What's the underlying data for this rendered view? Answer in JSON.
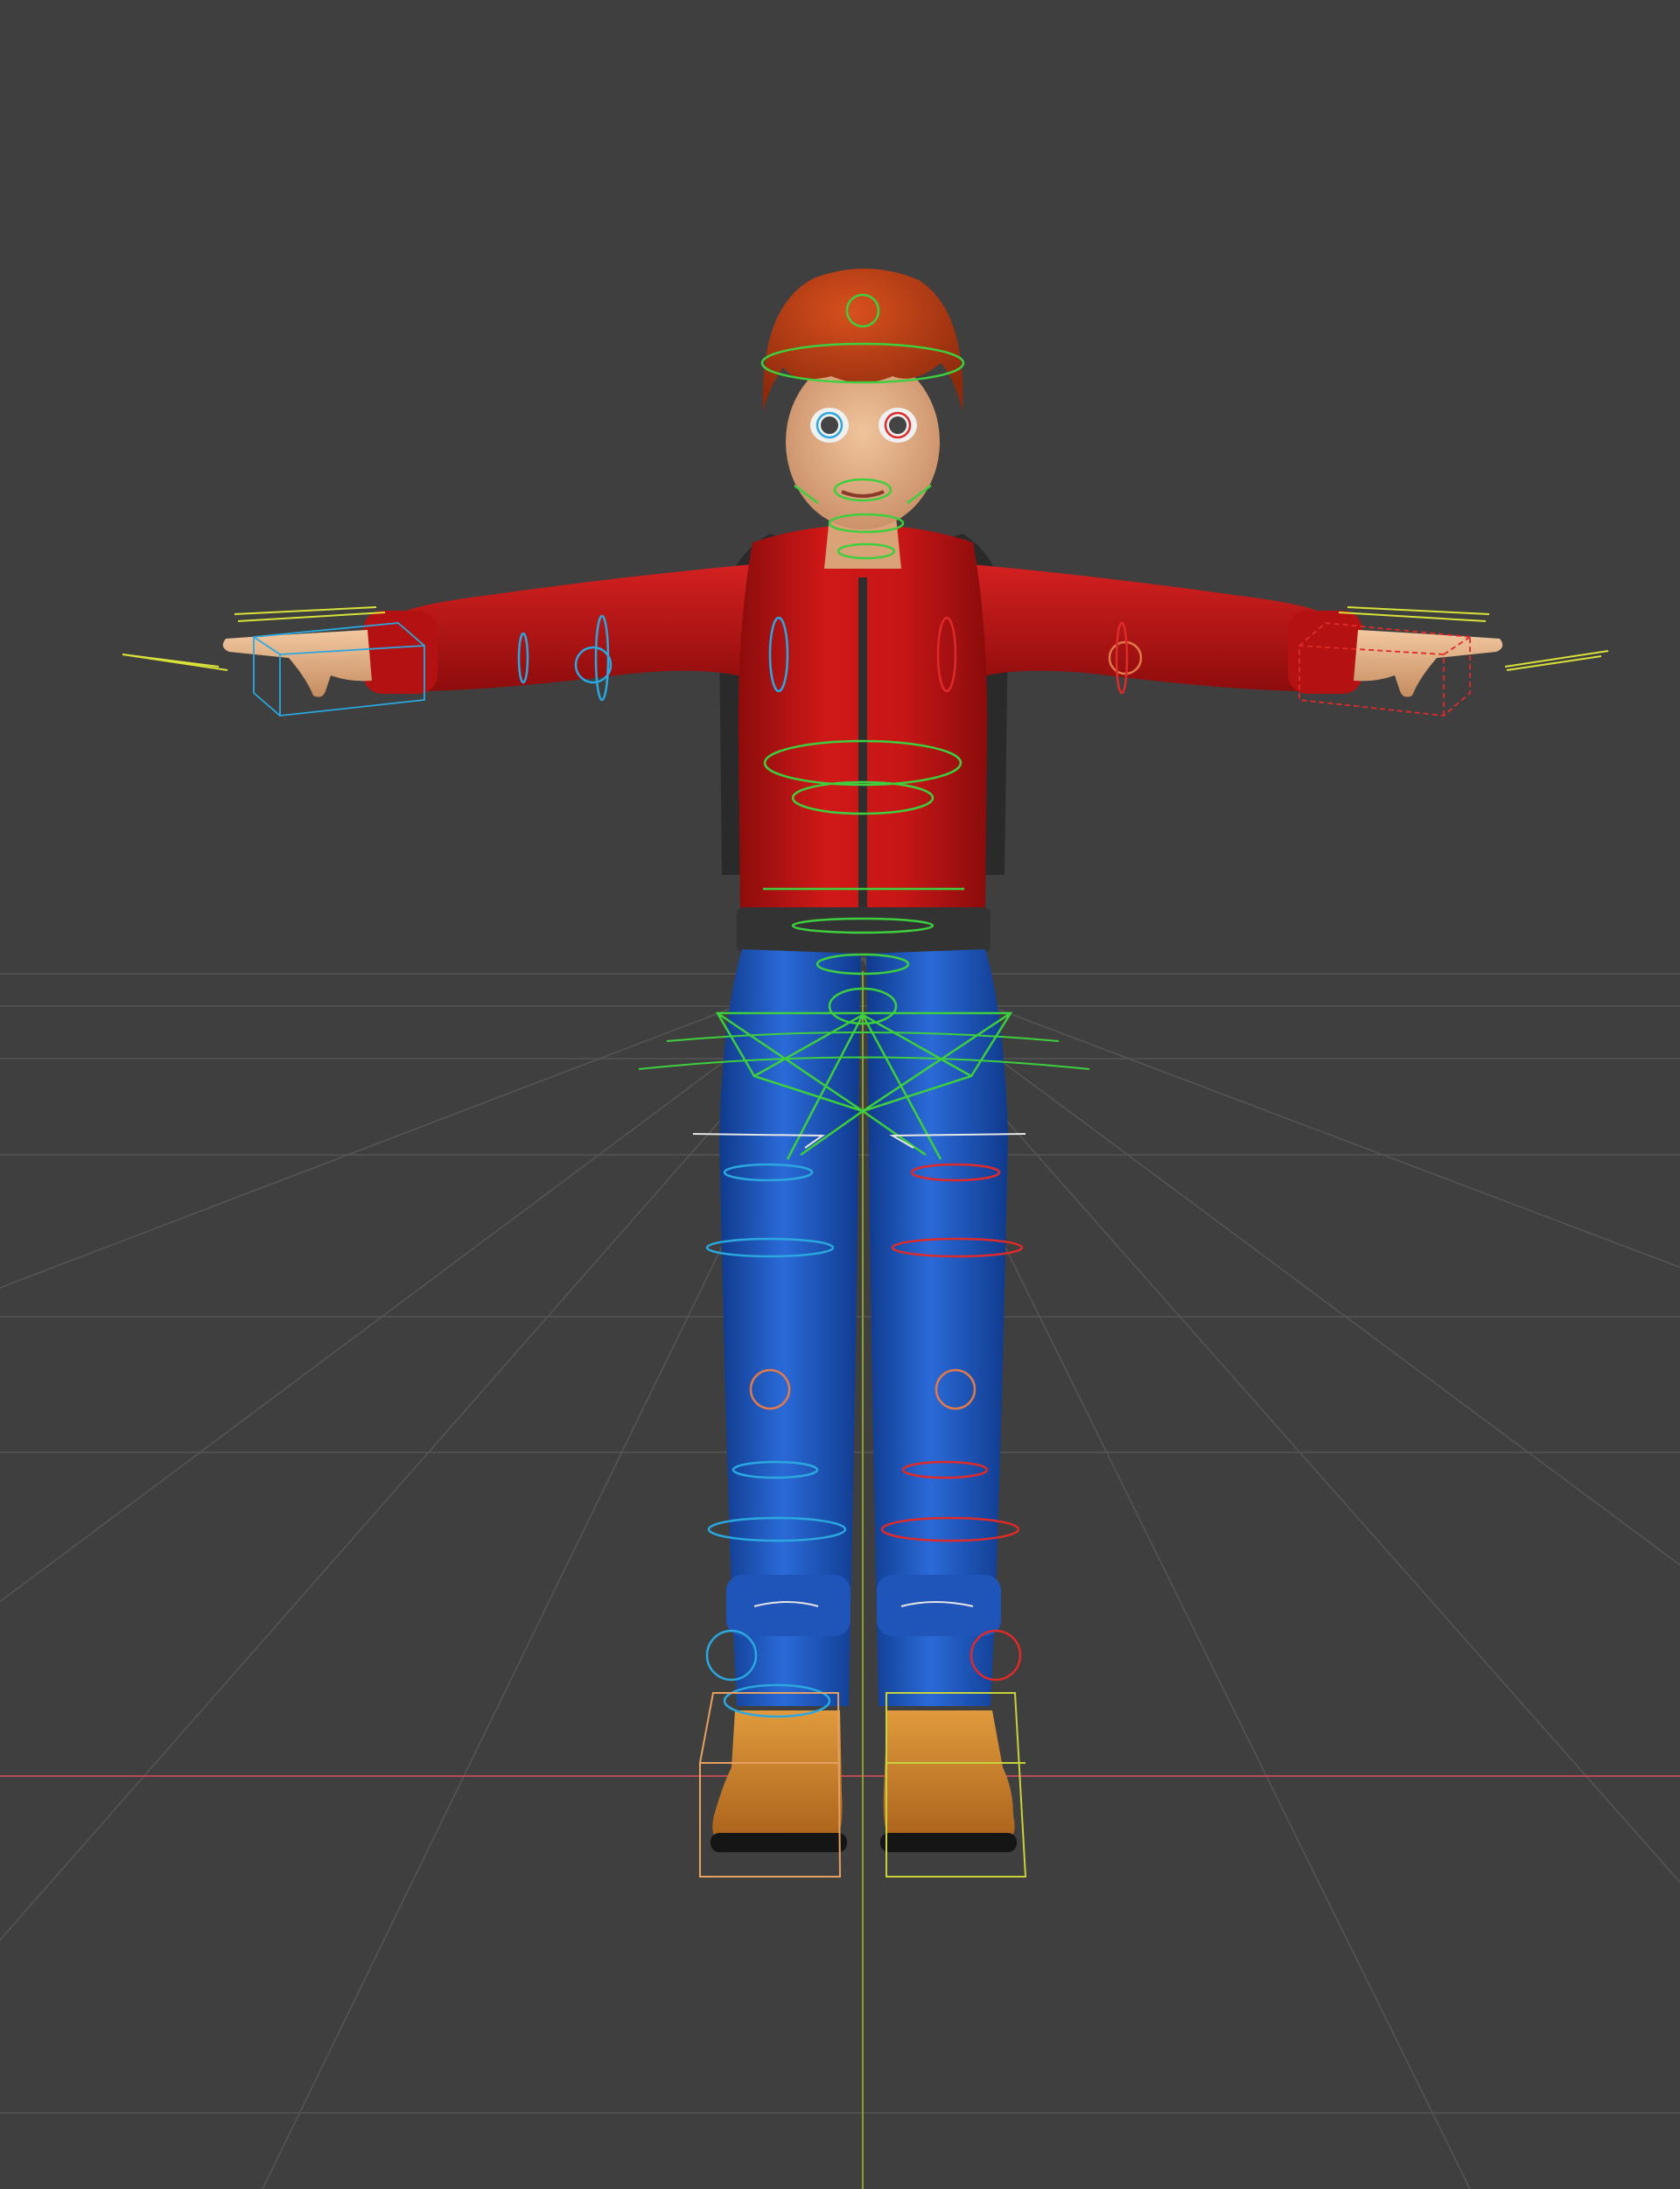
{
  "viewport": {
    "background_color": "#3f3f3f",
    "grid_color": "#555555",
    "x_axis_color": "#c0505a",
    "y_axis_color": "#8aa02a"
  },
  "character": {
    "skin_color": "#e8b48a",
    "hair_color": "#c23a14",
    "jacket_color": "#c41414",
    "pants_color": "#1e5cc8",
    "boots_color": "#d2862c",
    "backpack_color": "#2a2a2a"
  },
  "rig": {
    "center_control_color": "#3ecf3e",
    "left_control_color": "#2ba8e0",
    "right_control_color": "#e02a2a",
    "hand_detail_color": "#d8e23a",
    "neutral_control_color": "#e6e6e6",
    "foot_left_box_color": "#e6a060",
    "foot_right_box_color": "#c8d23a"
  }
}
